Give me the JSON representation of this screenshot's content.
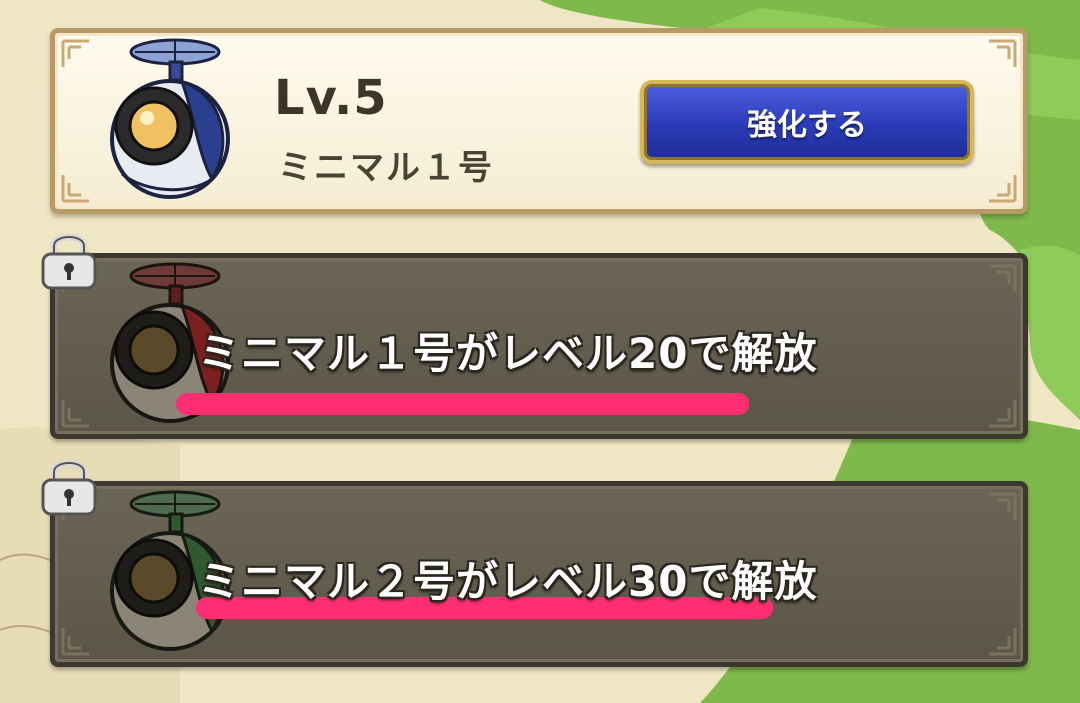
{
  "colors": {
    "upgrade_button": "#2a3bb8",
    "underline_highlight": "#ff2e73",
    "robot1_color": "#2c3f8f",
    "robot2_color": "#7b1f1f",
    "robot3_color": "#2f5a2f"
  },
  "active_robot": {
    "level": "Lv.5",
    "name": "ミニマル１号",
    "upgrade_label": "強化する",
    "icon": "robot-blue-icon"
  },
  "locked_robots": [
    {
      "message": "ミニマル１号がレベル20で解放",
      "icon": "robot-red-icon",
      "lock_icon": "padlock-icon"
    },
    {
      "message": "ミニマル２号がレベル30で解放",
      "icon": "robot-green-icon",
      "lock_icon": "padlock-icon"
    }
  ]
}
